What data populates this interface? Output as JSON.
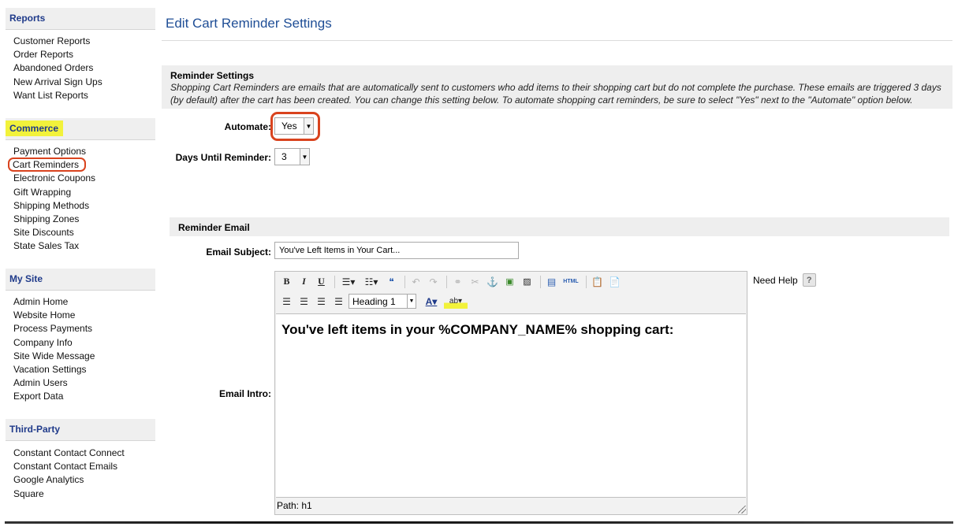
{
  "sidebar": {
    "sections": [
      {
        "title": "Reports",
        "items": [
          "Customer Reports",
          "Order Reports",
          "Abandoned Orders",
          "New Arrival Sign Ups",
          "Want List Reports"
        ]
      },
      {
        "title": "Commerce",
        "items": [
          "Payment Options",
          "Cart Reminders",
          "Electronic Coupons",
          "Gift Wrapping",
          "Shipping Methods",
          "Shipping Zones",
          "Site Discounts",
          "State Sales Tax"
        ]
      },
      {
        "title": "My Site",
        "items": [
          "Admin Home",
          "Website Home",
          "Process Payments",
          "Company Info",
          "Site Wide Message",
          "Vacation Settings",
          "Admin Users",
          "Export Data"
        ]
      },
      {
        "title": "Third-Party",
        "items": [
          "Constant Contact Connect",
          "Constant Contact Emails",
          "Google Analytics",
          "Square"
        ]
      }
    ]
  },
  "main": {
    "title": "Edit Cart Reminder Settings",
    "reminder_settings": {
      "title": "Reminder Settings",
      "description": "Shopping Cart Reminders are emails that are automatically sent to customers who add items to their shopping cart but do not complete the purchase. These emails are triggered 3 days (by default) after the cart has been created. You can change this setting below. To automate shopping cart reminders, be sure to select \"Yes\" next to the \"Automate\" option below.",
      "automate_label": "Automate:",
      "automate_value": "Yes",
      "days_label": "Days Until Reminder:",
      "days_value": "3"
    },
    "reminder_email": {
      "title": "Reminder Email",
      "subject_label": "Email Subject:",
      "subject_value": "You've Left Items in Your Cart...",
      "intro_label": "Email Intro:",
      "format_value": "Heading 1",
      "content": "You've left items in your %COMPANY_NAME% shopping cart:",
      "path_text": "Path: h1",
      "need_help": "Need Help",
      "help_glyph": "?",
      "html_button": "HTML"
    }
  }
}
